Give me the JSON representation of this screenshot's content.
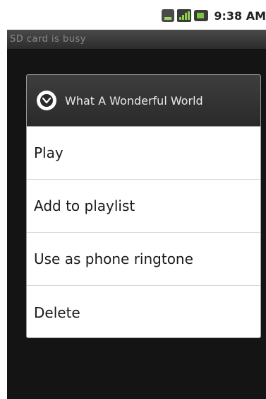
{
  "status_bar": {
    "time": "9:38 AM",
    "icons": [
      "3g-data-icon",
      "signal-strength-icon",
      "battery-icon"
    ],
    "accent_color": "#8bd14a"
  },
  "notice": {
    "text": "SD card is busy"
  },
  "dialog": {
    "title": "What A Wonderful World",
    "title_icon": "chevron-down-circle-icon",
    "items": [
      {
        "label": "Play"
      },
      {
        "label": "Add to playlist"
      },
      {
        "label": "Use as phone ringtone"
      },
      {
        "label": "Delete"
      }
    ]
  }
}
